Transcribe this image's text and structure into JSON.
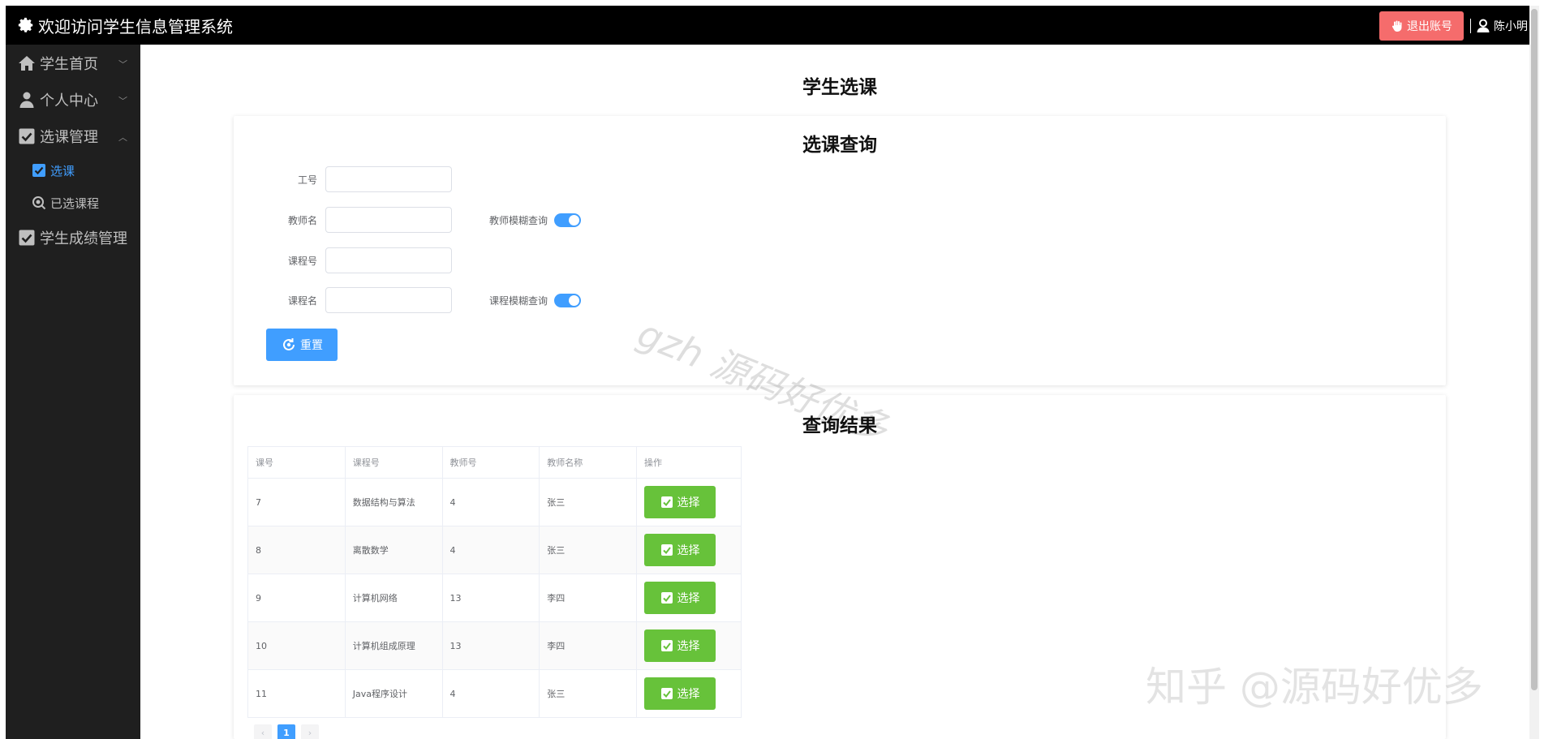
{
  "header": {
    "title": "欢迎访问学生信息管理系统",
    "logout_label": "退出账号",
    "username": "陈小明"
  },
  "sidebar": {
    "items": [
      {
        "label": "学生首页",
        "icon": "home-icon",
        "arrow": "﹀"
      },
      {
        "label": "个人中心",
        "icon": "person-icon",
        "arrow": "﹀"
      },
      {
        "label": "选课管理",
        "icon": "checkbox-icon",
        "arrow": "︿"
      },
      {
        "label": "学生成绩管理",
        "icon": "checkbox-icon"
      }
    ],
    "sub_items": [
      {
        "label": "选课",
        "icon": "checkbox-icon",
        "active": true
      },
      {
        "label": "已选课程",
        "icon": "search-icon",
        "active": false
      }
    ]
  },
  "page": {
    "title": "学生选课"
  },
  "query": {
    "title": "选课查询",
    "fields": [
      {
        "label": "工号",
        "value": ""
      },
      {
        "label": "教师名",
        "value": "",
        "switch_label": "教师模糊查询",
        "switch_on": true
      },
      {
        "label": "课程号",
        "value": ""
      },
      {
        "label": "课程名",
        "value": "",
        "switch_label": "课程模糊查询",
        "switch_on": true
      }
    ],
    "reset_label": "重置"
  },
  "results": {
    "title": "查询结果",
    "columns": [
      "课号",
      "课程号",
      "教师号",
      "教师名称",
      "操作"
    ],
    "rows": [
      {
        "cid": "7",
        "course": "数据结构与算法",
        "tid": "4",
        "teacher": "张三",
        "action": "选择"
      },
      {
        "cid": "8",
        "course": "离散数学",
        "tid": "4",
        "teacher": "张三",
        "action": "选择"
      },
      {
        "cid": "9",
        "course": "计算机网络",
        "tid": "13",
        "teacher": "李四",
        "action": "选择"
      },
      {
        "cid": "10",
        "course": "计算机组成原理",
        "tid": "13",
        "teacher": "李四",
        "action": "选择"
      },
      {
        "cid": "11",
        "course": "Java程序设计",
        "tid": "4",
        "teacher": "张三",
        "action": "选择"
      }
    ],
    "pagination": {
      "prev": "‹",
      "current": "1",
      "next": "›"
    }
  },
  "watermarks": [
    "gzh 源码好优多",
    "知乎 @源码好优多"
  ],
  "colors": {
    "primary": "#409eff",
    "success": "#67c23a",
    "danger": "#f56c6c",
    "sidebar": "#1f1f1f",
    "header": "#000000"
  }
}
